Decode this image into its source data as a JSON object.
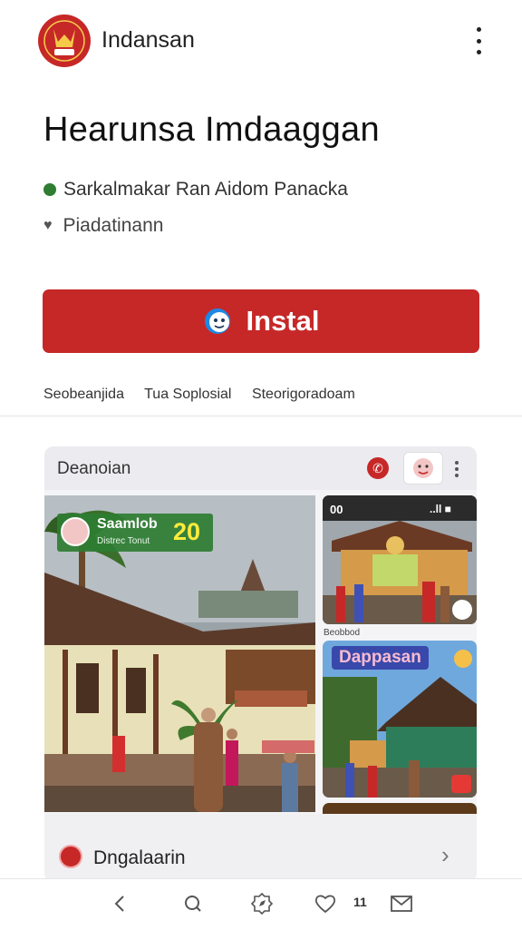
{
  "app": {
    "name": "Indansan",
    "title": "Hearunsa Imdaaggan",
    "developer": "Sarkalmakar Ran Aidom Panacka",
    "category": "Piadatinann",
    "install_label": "Instal"
  },
  "meta": [
    "Seobeanjida",
    "Tua Soplosial",
    "Steorigoradoam"
  ],
  "card": {
    "title": "Deanoian",
    "badge": {
      "name": "Saamlob",
      "sub": "Distrec Tonut",
      "number": "20"
    },
    "thumb1": {
      "status_left": "00",
      "status_right": "..ll ■"
    },
    "thumb_caption": "Beobbod",
    "thumb2_label": "Dappasan",
    "footer_label": "Dngalaarin"
  },
  "nav": {
    "count": "11"
  },
  "colors": {
    "brand_red": "#c62828",
    "badge_green": "#2e7d32"
  },
  "icons": [
    "app-logo-icon",
    "more-options-icon",
    "verified-icon",
    "heart-icon",
    "install-face-icon",
    "back-icon",
    "search-icon",
    "compass-icon",
    "favorite-icon",
    "mail-icon",
    "chevron-right-icon"
  ]
}
